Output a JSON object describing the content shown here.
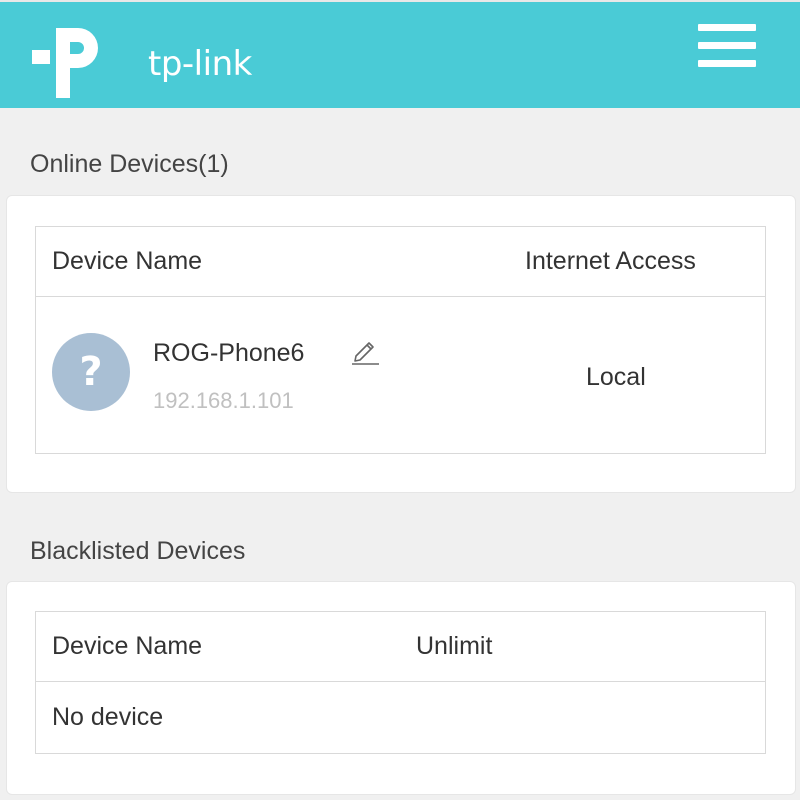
{
  "header": {
    "brand": "tp-link",
    "logo_icon": "tp-link-logo",
    "menu_icon": "hamburger-menu-icon",
    "color": "#4acbd6"
  },
  "online": {
    "title": "Online Devices(1)",
    "columns": [
      "Device Name",
      "Internet Access"
    ],
    "devices": [
      {
        "icon": "question-mark-icon",
        "name": "ROG-Phone6",
        "ip": "192.168.1.101",
        "access": "Local"
      }
    ]
  },
  "blacklist": {
    "title": "Blacklisted Devices",
    "columns": [
      "Device Name",
      "Unlimit"
    ],
    "empty_text": "No device"
  }
}
